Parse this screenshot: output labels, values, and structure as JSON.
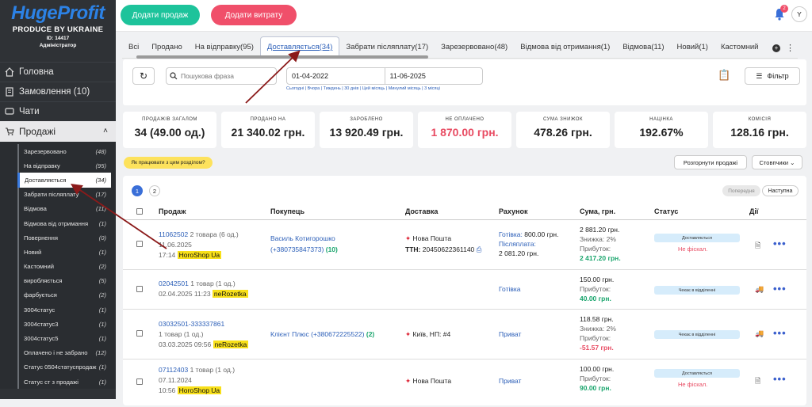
{
  "sidebar": {
    "logo": "HugeProfit",
    "tagline": "PRODUCE BY UKRAINE",
    "id_text": "ID: 14417",
    "role": "Адміністратор",
    "main": [
      "Головна",
      "Замовлення (10)",
      "Чати"
    ],
    "sales_label": "Продажі",
    "items": [
      {
        "label": "Зарезервовано",
        "count": "(48)"
      },
      {
        "label": "На відправку",
        "count": "(95)"
      },
      {
        "label": "Доставляється",
        "count": "(34)"
      },
      {
        "label": "Забрати післяплату",
        "count": "(17)"
      },
      {
        "label": "Відмова",
        "count": "(11)"
      },
      {
        "label": "Відмова від отримання",
        "count": "(1)"
      },
      {
        "label": "Повернення",
        "count": "(0)"
      },
      {
        "label": "Новий",
        "count": "(1)"
      },
      {
        "label": "Кастомний",
        "count": "(2)"
      },
      {
        "label": "виробляється",
        "count": "(5)"
      },
      {
        "label": "фарбується",
        "count": "(2)"
      },
      {
        "label": "3004статус",
        "count": "(1)"
      },
      {
        "label": "3004статус3",
        "count": "(1)"
      },
      {
        "label": "3004статус5",
        "count": "(1)"
      },
      {
        "label": "Оплачено і не забрано",
        "count": "(12)"
      },
      {
        "label": "Статус 0504статуспродаж",
        "count": "(1)"
      },
      {
        "label": "Статус ст з продажі",
        "count": "(1)"
      }
    ]
  },
  "topbar": {
    "add_sale": "Додати продаж",
    "add_expense": "Додати витрату",
    "notif_count": "2",
    "avatar": "Y"
  },
  "tabs": [
    "Всі",
    "Продано",
    "На відправку(95)",
    "Доставляється(34)",
    "Забрати післяплату(17)",
    "Зарезервовано(48)",
    "Відмова від отримання(1)",
    "Відмова(11)",
    "Новий(1)",
    "Кастомний"
  ],
  "filters": {
    "search_placeholder": "Пошукова фраза",
    "date_from": "01-04-2022",
    "date_to": "11-06-2025",
    "presets": "Сьогодні | Вчора | Тиждень | 30 днів | Цей місяць | Минулий місяць | 3 місяці",
    "filter_label": "Фільтр"
  },
  "stats": [
    {
      "label": "ПРОДАЖІВ ЗАГАЛОМ",
      "value": "34 (49.00 од.)"
    },
    {
      "label": "ПРОДАНО НА",
      "value": "21 340.02 грн."
    },
    {
      "label": "ЗАРОБЛЕНО",
      "value": "13 920.49 грн."
    },
    {
      "label": "НЕ ОПЛАЧЕНО",
      "value": "1 870.00 грн."
    },
    {
      "label": "СУМА ЗНИЖОК",
      "value": "478.26 грн."
    },
    {
      "label": "НАЦІНКА",
      "value": "192.67%"
    },
    {
      "label": "КОМІСІЯ",
      "value": "128.16 грн."
    }
  ],
  "help": "Як працювати з цим розділом?",
  "expand": "Розгорнути продажі",
  "columns": "Стовпчики",
  "pagination": {
    "p1": "1",
    "p2": "2",
    "prev": "Попередня",
    "next": "Наступна"
  },
  "headers": [
    "Продаж",
    "Покупець",
    "Доставка",
    "Рахунок",
    "Сума, грн.",
    "Статус",
    "Дії"
  ],
  "rows": [
    {
      "id": "11062502",
      "items": "2 товара (6 од.)",
      "date": "11.06.2025",
      "time": "17:14",
      "source": "HoroShop Ua",
      "buyer": "Василь Котигорошко",
      "phone": "(+380735847373)",
      "orders": "(10)",
      "delivery": "Нова Пошта",
      "ttn_label": "ТТН:",
      "ttn": "20450622361140",
      "pay1": "Готівка:",
      "pay1v": "800.00 грн.",
      "pay2": "Післяплата:",
      "pay2v": "2 081.20 грн.",
      "sum": "2 881.20 грн.",
      "disc": "Знижка: 2%",
      "profit_l": "Прибуток:",
      "profit": "2 417.20 грн.",
      "status": "Доставляється",
      "fiscal": "Не фіскал."
    },
    {
      "id": "02042501",
      "items": "1 товар (1 од.)",
      "date": "02.04.2025 11:23",
      "source": "neRozetka",
      "pay": "Готівка",
      "sum": "150.00 грн.",
      "profit_l": "Прибуток:",
      "profit": "40.00 грн.",
      "status": "Чекає в відділенні"
    },
    {
      "id": "03032501-333337861",
      "items": "1 товар (1 од.)",
      "date": "03.03.2025 09:56",
      "source": "neRozetka",
      "buyer": "Клієнт Плюс (+380672225522)",
      "orders": "(2)",
      "delivery": "Київ, НП: #4",
      "pay": "Приват",
      "sum": "118.58 грн.",
      "disc": "Знижка: 2%",
      "profit_l": "Прибуток:",
      "profit": "-51.57 грн.",
      "status": "Чекає в відділенні"
    },
    {
      "id": "07112403",
      "items": "1 товар (1 од.)",
      "date": "07.11.2024",
      "time": "10:56",
      "source": "HoroShop Ua",
      "delivery": "Нова Пошта",
      "pay": "Приват",
      "sum": "100.00 грн.",
      "profit_l": "Прибуток:",
      "profit": "90.00 грн.",
      "status": "Доставляється",
      "fiscal": "Не фіскал."
    }
  ]
}
